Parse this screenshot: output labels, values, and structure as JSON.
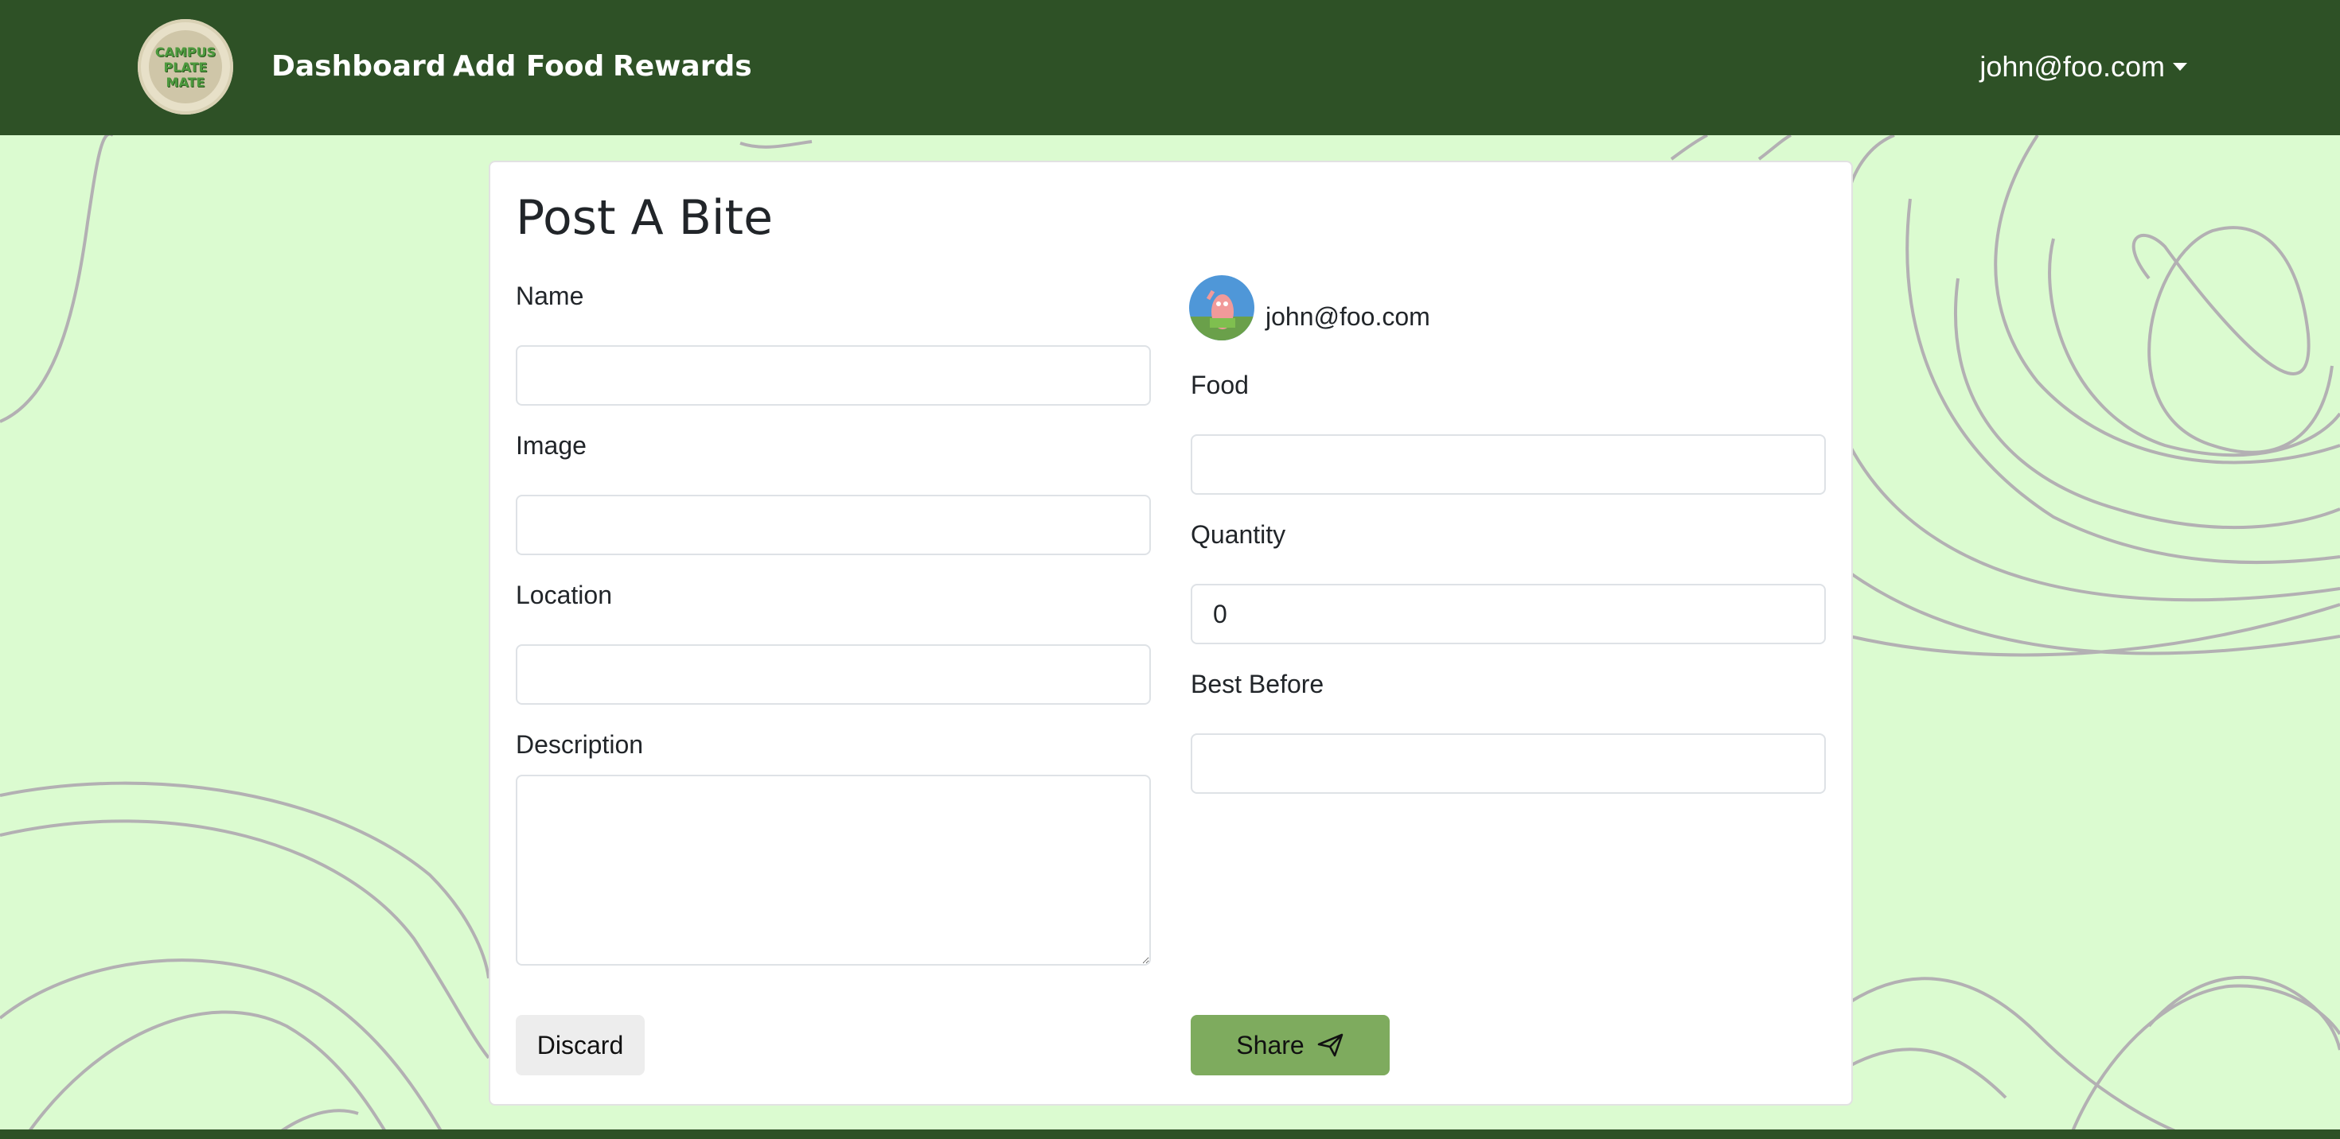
{
  "colors": {
    "navbar": "#2e5126",
    "background": "#dbfbd0",
    "share_button": "#7eab5e",
    "discard_button": "#ededed",
    "topo_lines": "#b3b0b3"
  },
  "navbar": {
    "logo_lines": [
      "CAMPUS",
      "PLATE",
      "MATE"
    ],
    "links": [
      {
        "label": "Dashboard"
      },
      {
        "label": "Add Food"
      },
      {
        "label": "Rewards"
      }
    ],
    "user_menu": {
      "label": "john@foo.com",
      "icon": "caret-down-icon"
    }
  },
  "form": {
    "title": "Post A Bite",
    "fields": {
      "name": {
        "label": "Name",
        "value": ""
      },
      "image": {
        "label": "Image",
        "value": ""
      },
      "location": {
        "label": "Location",
        "value": ""
      },
      "description": {
        "label": "Description",
        "value": ""
      },
      "food": {
        "label": "Food",
        "value": ""
      },
      "quantity": {
        "label": "Quantity",
        "value": "0"
      },
      "best_before": {
        "label": "Best Before",
        "value": ""
      }
    },
    "owner": {
      "email": "john@foo.com",
      "avatar_icon": "user-avatar"
    },
    "buttons": {
      "discard": "Discard",
      "share": "Share",
      "share_icon": "send-icon"
    }
  }
}
